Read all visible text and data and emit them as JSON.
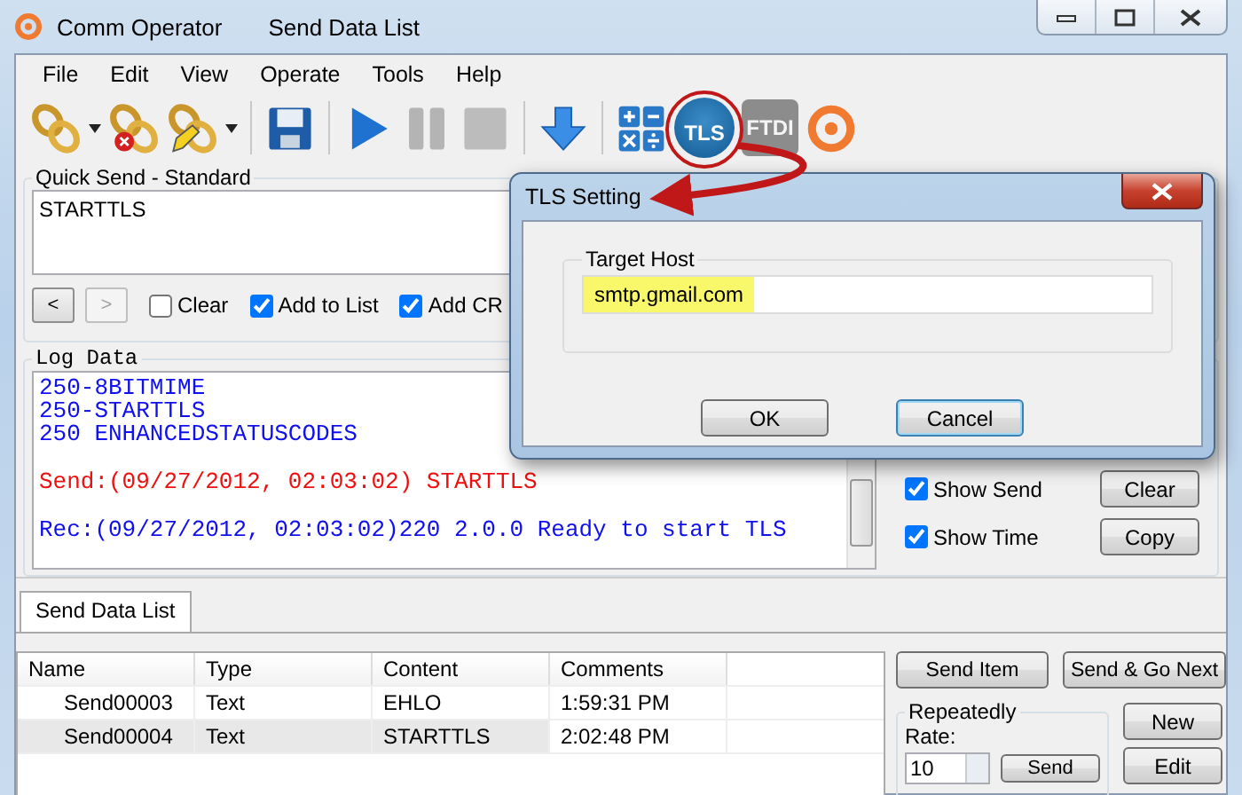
{
  "window": {
    "title": "Comm Operator",
    "document": "Send Data List"
  },
  "menu": [
    "File",
    "Edit",
    "View",
    "Operate",
    "Tools",
    "Help"
  ],
  "toolbar": {
    "tls_label": "TLS",
    "ftdi_label": "FTDI",
    "ftdi_disabled": true
  },
  "quick_send": {
    "title": "Quick Send - Standard",
    "value": "STARTTLS",
    "nav": [
      {
        "label": "<",
        "disabled": false
      },
      {
        "label": ">",
        "disabled": true
      }
    ],
    "options": [
      {
        "label": "Clear",
        "checked": false
      },
      {
        "label": "Add to List",
        "checked": true
      },
      {
        "label": "Add CR",
        "checked": true
      }
    ]
  },
  "log": {
    "title": "Log Data",
    "lines": [
      {
        "kind": "response",
        "text": "250-8BITMIME"
      },
      {
        "kind": "response",
        "text": "250-STARTTLS"
      },
      {
        "kind": "response",
        "text": "250 ENHANCEDSTATUSCODES"
      },
      {
        "kind": "sent",
        "text": "Send:(09/27/2012, 02:03:02) STARTTLS"
      },
      {
        "kind": "received",
        "text": "Rec:(09/27/2012, 02:03:02)220 2.0.0 Ready to start TLS"
      }
    ],
    "options": [
      {
        "label": "Show Send",
        "checked": true,
        "button": "Clear"
      },
      {
        "label": "Show Time",
        "checked": true,
        "button": "Copy"
      }
    ]
  },
  "tabs": [
    {
      "label": "Send Data List",
      "selected": true
    }
  ],
  "table": {
    "columns": [
      "Name",
      "Type",
      "Content",
      "Comments"
    ],
    "rows": [
      {
        "cells": [
          "Send00003",
          "Text",
          "EHLO",
          "1:59:31 PM"
        ],
        "selected": false
      },
      {
        "cells": [
          "Send00004",
          "Text",
          "STARTTLS",
          "2:02:48 PM"
        ],
        "selected": true
      }
    ]
  },
  "actions": [
    "Send Item",
    "Send & Go Next"
  ],
  "repeatedly": {
    "title": "Repeatedly",
    "rate_label": "Rate:",
    "rate": "10",
    "send": "Send"
  },
  "list_buttons": [
    "New",
    "Edit"
  ],
  "dialog": {
    "title": "TLS Setting",
    "group": "Target Host",
    "host": "smtp.gmail.com",
    "highlighted": true,
    "buttons": [
      {
        "label": "OK",
        "focused": false
      },
      {
        "label": "Cancel",
        "focused": true
      }
    ]
  }
}
